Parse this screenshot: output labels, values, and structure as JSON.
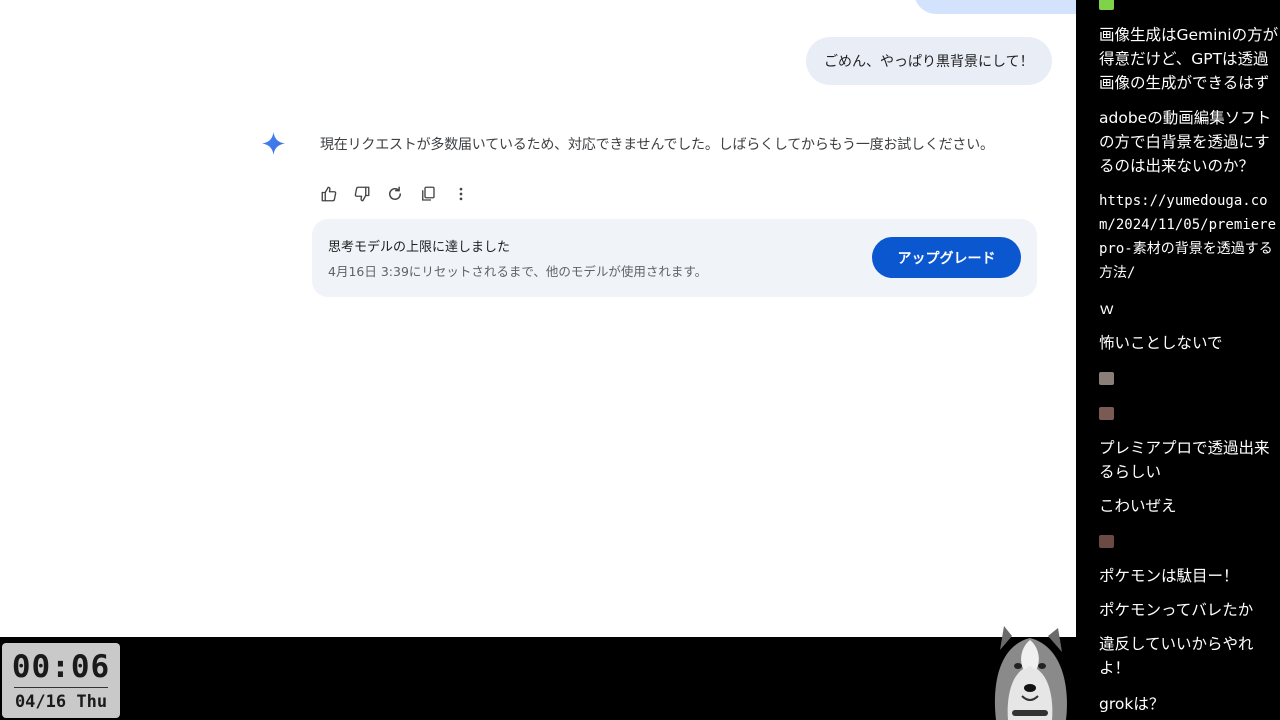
{
  "chat": {
    "user_message": "ごめん、やっぱり黒背景にして！",
    "response_text": "現在リクエストが多数届いているため、対応できませんでした。しばらくしてからもう一度お試しください。",
    "actions": [
      {
        "icon": "thumb-up-icon"
      },
      {
        "icon": "thumb-down-icon"
      },
      {
        "icon": "refresh-icon"
      },
      {
        "icon": "copy-icon"
      },
      {
        "icon": "more-vert-icon"
      }
    ],
    "limit_card": {
      "title": "思考モデルの上限に達しました",
      "subtitle": "4月16日 3:39にリセットされるまで、他のモデルが使用されます。",
      "upgrade_label": "アップグレード"
    }
  },
  "clock": {
    "time": "00:06",
    "date": "04/16 Thu"
  },
  "comments": [
    {
      "type": "text",
      "text": "画像生成はGeminiの方が得意だけど、GPTは透過画像の生成ができるはず"
    },
    {
      "type": "text",
      "text": "adobeの動画編集ソフトの方で白背景を透過にするのは出来ないのか？"
    },
    {
      "type": "text",
      "text": "https://yumedouga.com/2024/11/05/premierepro-素材の背景を透過する方法/"
    },
    {
      "type": "text",
      "text": "ｗ"
    },
    {
      "type": "text",
      "text": "怖いことしないで"
    },
    {
      "type": "icon"
    },
    {
      "type": "icon"
    },
    {
      "type": "text",
      "text": "プレミアプロで透過出来るらしい"
    },
    {
      "type": "text",
      "text": "こわいぜえ"
    },
    {
      "type": "icon"
    },
    {
      "type": "text",
      "text": "ポケモンは駄目ー！"
    },
    {
      "type": "text",
      "text": "ポケモンってバレたか"
    },
    {
      "type": "text",
      "text": "違反していいからやれよ！"
    },
    {
      "type": "text",
      "text": "grokは？"
    }
  ],
  "colors": {
    "accent": "#0b57d0",
    "user_bubble": "#e9eef6",
    "card_bg": "#f0f4f9",
    "comment_bg": "#000000"
  }
}
